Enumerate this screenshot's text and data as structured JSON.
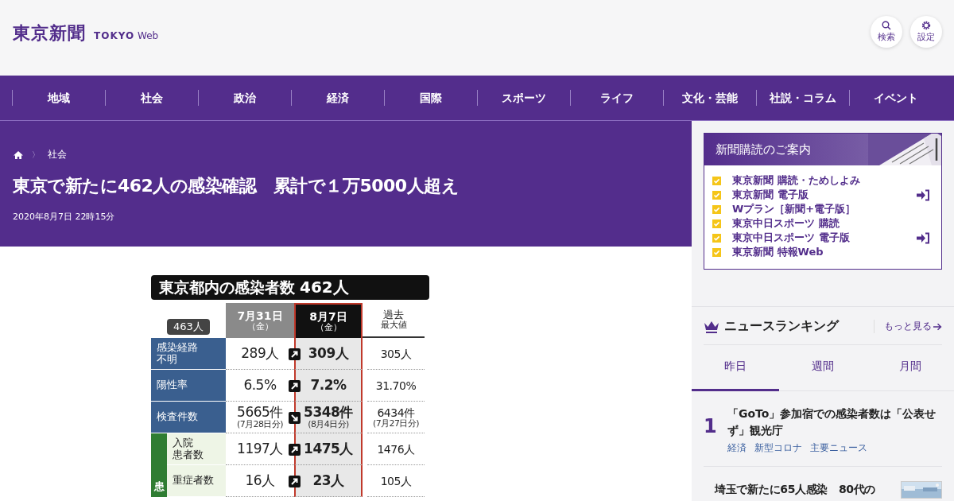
{
  "header": {
    "logo": "東京新聞",
    "logo_sub_bold": "TOKYO",
    "logo_sub": "Web",
    "actions": [
      {
        "kind": "search",
        "label": "検索"
      },
      {
        "kind": "settings",
        "label": "設定"
      }
    ]
  },
  "nav": [
    "地域",
    "社会",
    "政治",
    "経済",
    "国際",
    "スポーツ",
    "ライフ",
    "文化・芸能",
    "社説・コラム",
    "イベント"
  ],
  "article": {
    "breadcrumb_separator": "〉",
    "breadcrumb": [
      "社会"
    ],
    "title": "東京で新たに462人の感染確認　累計で１万5000人超え",
    "date": "2020年8月7日 22時15分"
  },
  "graphic": {
    "title": "東京都内の感染者数",
    "title_count": "462人",
    "prev_count": "463人",
    "columns": [
      {
        "lines": [
          "7月31日",
          "（金）"
        ],
        "kind": "prev"
      },
      {
        "lines": [
          "8月7日",
          "（金）"
        ],
        "kind": "current"
      },
      {
        "lines": [
          "過去",
          "最大値"
        ],
        "kind": "max"
      }
    ],
    "rows": [
      {
        "label": [
          "感染経路",
          "不明"
        ],
        "in_group": false,
        "color": "#3a5f8f",
        "prev": "289人",
        "kind": "up",
        "current": "309人",
        "max": "305人"
      },
      {
        "label": [
          "陽性率"
        ],
        "in_group": false,
        "color": "#3a5f8f",
        "prev": "6.5%",
        "kind": "up",
        "current": "7.2%",
        "max": "31.70%"
      },
      {
        "label": [
          "検査件数"
        ],
        "in_group": false,
        "color": "#3a5f8f",
        "prev": "5665件",
        "prev_note": "(7月28日分)",
        "kind": "down",
        "current": "5348件",
        "current_note": "(8月4日分)",
        "max": "6434件",
        "max_note": "(7月27日分)"
      },
      {
        "label": [
          "入院",
          "患者数"
        ],
        "in_group": true,
        "color": "#eef5e6",
        "prev": "1197人",
        "kind": "up",
        "current": "1475人",
        "max": "1476人"
      },
      {
        "label": [
          "重症者数"
        ],
        "in_group": true,
        "color": "#eef5e6",
        "prev": "16人",
        "kind": "up",
        "current": "23人",
        "max": "105人"
      }
    ],
    "group_label": {
      "text": "患",
      "color": "#2f7d32"
    }
  },
  "subscribe": {
    "title": "新聞購読のご案内",
    "items": [
      {
        "label": "東京新聞 購読・ためしよみ",
        "login": false
      },
      {
        "label": "東京新聞 電子版",
        "login": true
      },
      {
        "label": "Wプラン［新聞+電子版］",
        "login": false
      },
      {
        "label": "東京中日スポーツ 購読",
        "login": false
      },
      {
        "label": "東京中日スポーツ 電子版",
        "login": true
      },
      {
        "label": "東京新聞 特報Web",
        "login": false
      }
    ]
  },
  "ranking": {
    "title": "ニュースランキング",
    "more": "もっと見る",
    "tabs": [
      {
        "label": "昨日",
        "selected": true
      },
      {
        "label": "週間",
        "selected": false
      },
      {
        "label": "月間",
        "selected": false
      }
    ],
    "items": [
      {
        "rank": "1",
        "title": "「GoTo」参加宿での感染者数は「公表せず」観光庁",
        "tags": [
          "経済",
          "新型コロナ",
          "主要ニュース"
        ]
      },
      {
        "title": "埼玉で新たに65人感染　80代の",
        "kind": "picture"
      }
    ]
  }
}
